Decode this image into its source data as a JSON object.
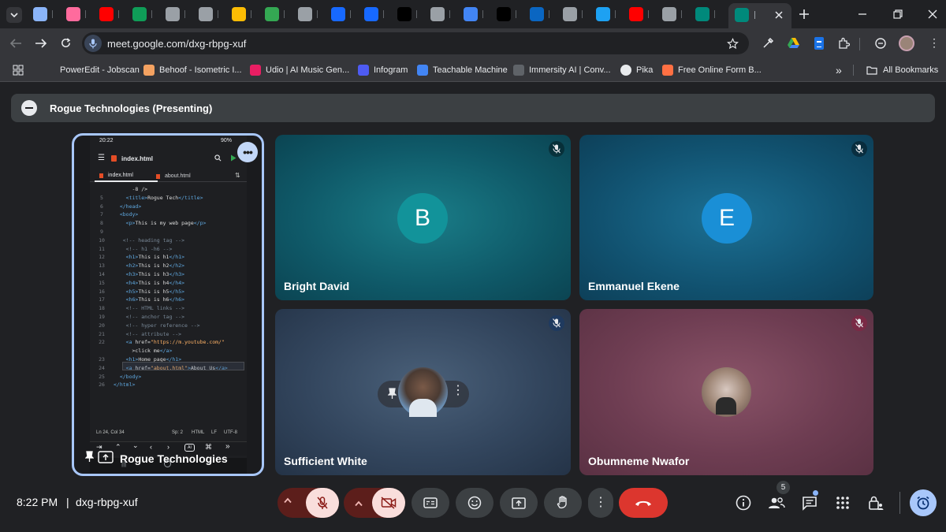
{
  "browser": {
    "url": "meet.google.com/dxg-rbpg-xuf",
    "tab_icon_colors": [
      "#8ab4f8",
      "#ff6b9d",
      "#ff0000",
      "#0f9d58",
      "#9aa0a6",
      "#9aa0a6",
      "#fbbc04",
      "#34a853",
      "#9aa0a6",
      "#1769ff",
      "#1769ff",
      "#000000",
      "#9aa0a6",
      "#4285f4",
      "#000000",
      "#0a66c2",
      "#9aa0a6",
      "#1da1f2",
      "#ff0000",
      "#9aa0a6",
      "#00897b",
      "#00897b"
    ],
    "bookmarks": [
      {
        "label": "PowerEdit - Jobscan",
        "color": "#35363a"
      },
      {
        "label": "Behoof - Isometric I...",
        "color": "#f4a261"
      },
      {
        "label": "Udio | AI Music Gen...",
        "color": "#e91e63"
      },
      {
        "label": "Infogram",
        "color": "#4e5bf2"
      },
      {
        "label": "Teachable Machine",
        "color": "#4285f4"
      },
      {
        "label": "Immersity AI | Conv...",
        "color": "#202124"
      },
      {
        "label": "Pika",
        "color": "#202124"
      },
      {
        "label": "Free Online Form B...",
        "color": "#ff7043"
      }
    ],
    "all_bookmarks": "All Bookmarks",
    "overflow": "»"
  },
  "meet": {
    "presenting_label": "Rogue Technologies (Presenting)",
    "presenter_name": "Rogue Technologies",
    "participants": [
      {
        "name": "Bright David",
        "initial": "B",
        "avatar_color": "#12939a"
      },
      {
        "name": "Emmanuel Ekene",
        "initial": "E",
        "avatar_color": "#1a8fd6"
      },
      {
        "name": "Sufficient White",
        "initial": ""
      },
      {
        "name": "Obumneme Nwafor",
        "initial": ""
      }
    ],
    "time": "8:22 PM",
    "separator": "|",
    "meeting_code": "dxg-rbpg-xuf",
    "people_count": "5"
  },
  "phone": {
    "status_time": "20:22",
    "status_battery": "90%",
    "file_title": "index.html",
    "tabs": [
      "index.html",
      "about.html"
    ],
    "code": [
      {
        "n": "",
        "t": "      -8\" />"
      },
      {
        "n": "5",
        "t": "    <title>Rogue Tech</title>"
      },
      {
        "n": "6",
        "t": "  </head>"
      },
      {
        "n": "7",
        "t": "  <body>"
      },
      {
        "n": "8",
        "t": "    <p>This is my web page</p>"
      },
      {
        "n": "9",
        "t": ""
      },
      {
        "n": "10",
        "t": "   <!-- heading tag -->"
      },
      {
        "n": "11",
        "t": "    <!-- h1 -h6 -->"
      },
      {
        "n": "12",
        "t": "    <h1>This is h1</h1>"
      },
      {
        "n": "13",
        "t": "    <h2>This is h2</h2>"
      },
      {
        "n": "14",
        "t": "    <h3>This is h3</h3>"
      },
      {
        "n": "15",
        "t": "    <h4>This is h4</h4>"
      },
      {
        "n": "16",
        "t": "    <h5>This is h5</h5>"
      },
      {
        "n": "17",
        "t": "    <h6>This is h6</h6>"
      },
      {
        "n": "18",
        "t": "    <!-- HTML links -->"
      },
      {
        "n": "19",
        "t": "    <!-- anchor tag -->"
      },
      {
        "n": "20",
        "t": "    <!-- hyper reference -->"
      },
      {
        "n": "21",
        "t": "    <!-- attribute -->"
      },
      {
        "n": "22",
        "t": "    <a href=\"https://m.youtube.com/\""
      },
      {
        "n": "",
        "t": "      >click me</a>"
      },
      {
        "n": "23",
        "t": "    <h1>Home page</h1>"
      },
      {
        "n": "24",
        "t": "    <a href=\"about.html\">About Us</a>"
      },
      {
        "n": "25",
        "t": "  </body>"
      },
      {
        "n": "26",
        "t": "</html>"
      }
    ],
    "status_bar": {
      "position": "Ln 24, Col 34",
      "spaces": "Sp: 2",
      "lang": "HTML",
      "eol": "LF",
      "enc": "UTF-8"
    },
    "ai_key": "AI"
  }
}
